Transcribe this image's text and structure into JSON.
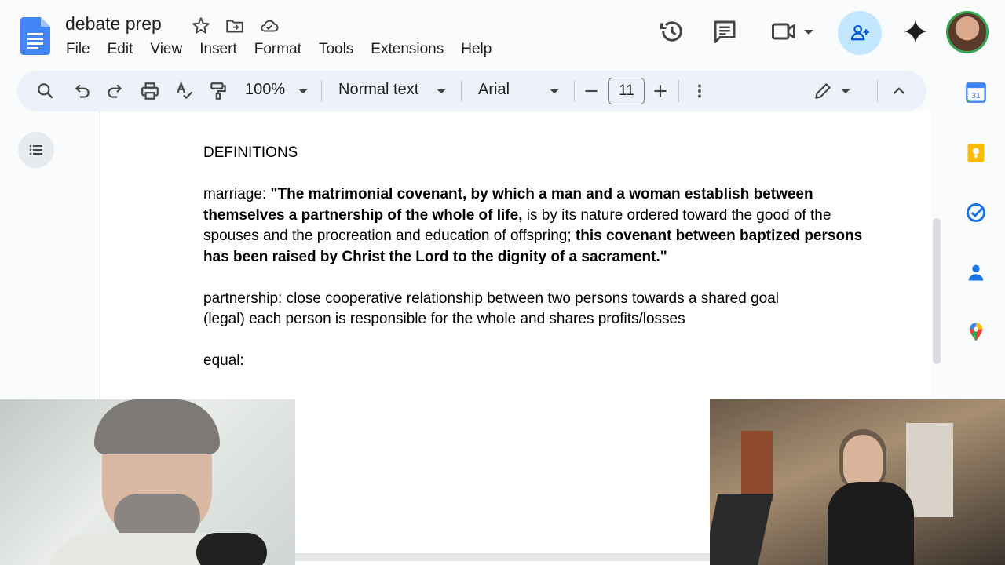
{
  "doc": {
    "title": "debate prep",
    "menu": [
      "File",
      "Edit",
      "View",
      "Insert",
      "Format",
      "Tools",
      "Extensions",
      "Help"
    ]
  },
  "toolbar": {
    "zoom": "100%",
    "style": "Normal text",
    "font": "Arial",
    "font_size": "11"
  },
  "content": {
    "heading": "DEFINITIONS",
    "marriage": {
      "label": "marriage: ",
      "bold1": "\"The matrimonial covenant, by which a man and a woman establish between themselves a partnership of the whole of life,",
      "normal": " is by its nature ordered toward the good of the spouses and the procreation and education of offspring; ",
      "bold2": "this covenant between baptized persons has been raised by Christ the Lord to the dignity of a sacrament.\""
    },
    "partnership_line1": "partnership: close cooperative relationship between two persons towards a shared goal",
    "partnership_line2": "(legal) each person is responsible for the whole and shares profits/losses",
    "equal": "equal:"
  },
  "icons": {
    "star": "star-icon",
    "move": "move-to-folder-icon",
    "cloud": "cloud-saved-icon",
    "history": "version-history-icon",
    "comments": "comments-icon",
    "meet": "meet-video-icon",
    "share": "share-person-add-icon",
    "gemini": "gemini-sparkle-icon"
  },
  "colors": {
    "docs_blue": "#4285f4",
    "toolbar_bg": "#edf2fa",
    "share_bg": "#c2e7ff"
  }
}
